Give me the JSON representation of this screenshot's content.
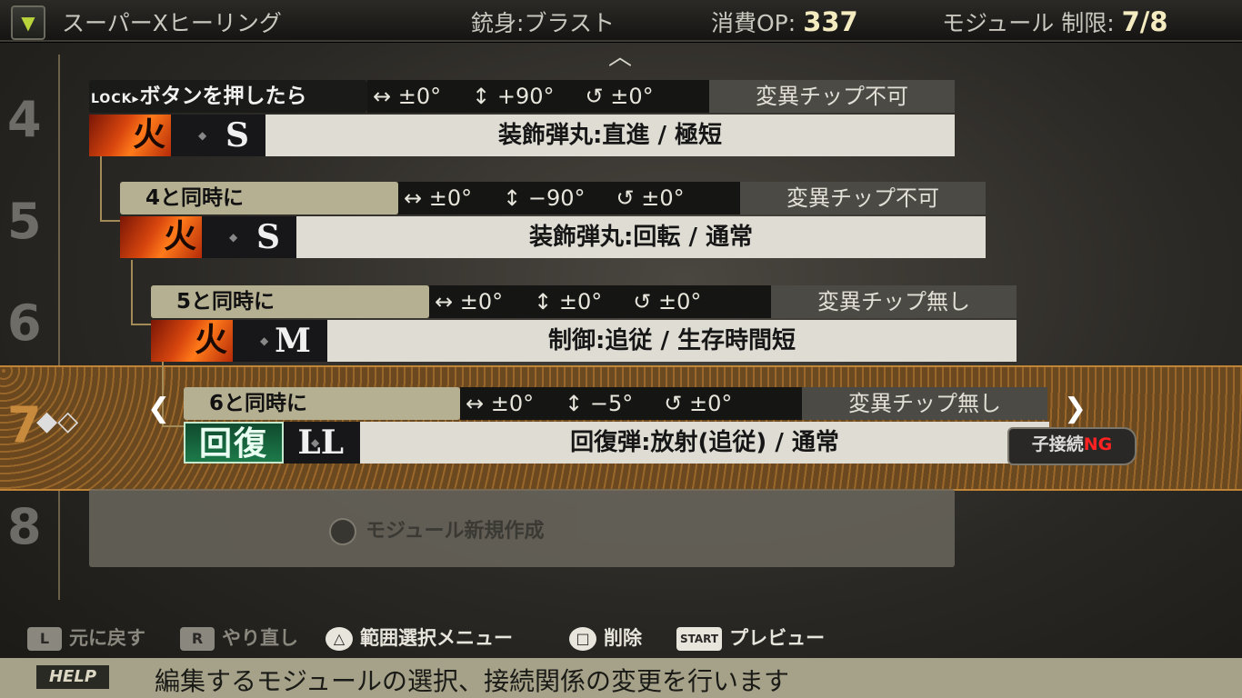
{
  "header": {
    "title": "スーパーXヒーリング",
    "barrel_label": "銃身:",
    "barrel_value": "ブラスト",
    "op_label": "消費OP:",
    "op_value": "337",
    "module_limit_label": "モジュール 制限:",
    "module_limit_value": "7/8"
  },
  "rows": [
    {
      "number": "4",
      "condition_prefix": "LOCK▸",
      "condition": "ボタンを押したら",
      "params": [
        "↔ ±0°",
        "↕ +90°",
        "↺ ±0°"
      ],
      "chip": "変異チップ不可",
      "element": "火",
      "size": "S",
      "description": "装飾弾丸:直進 / 極短"
    },
    {
      "number": "5",
      "condition": "4と同時に",
      "params": [
        "↔ ±0°",
        "↕ −90°",
        "↺ ±0°"
      ],
      "chip": "変異チップ不可",
      "element": "火",
      "size": "S",
      "description": "装飾弾丸:回転 / 通常"
    },
    {
      "number": "6",
      "condition": "5と同時に",
      "params": [
        "↔ ±0°",
        "↕ ±0°",
        "↺ ±0°"
      ],
      "chip": "変異チップ無し",
      "element": "火",
      "size": "M",
      "description": "制御:追従 / 生存時間短"
    },
    {
      "number": "7",
      "condition": "6と同時に",
      "params": [
        "↔ ±0°",
        "↕ −5°",
        "↺ ±0°"
      ],
      "chip": "変異チップ無し",
      "element": "回復",
      "size": "LL",
      "description": "回復弾:放射(追従) / 通常",
      "badge_prefix": "子接続",
      "badge_status": "NG"
    },
    {
      "number": "8",
      "new_module_label": "モジュール新規作成"
    }
  ],
  "controls": [
    {
      "button": "L",
      "label": "元に戻す",
      "enabled": false
    },
    {
      "button": "R",
      "label": "やり直し",
      "enabled": false
    },
    {
      "button": "△",
      "label": "範囲選択メニュー",
      "enabled": true
    },
    {
      "button": "□",
      "label": "削除",
      "enabled": true
    },
    {
      "button": "START",
      "label": "プレビュー",
      "enabled": true
    }
  ],
  "help": {
    "tag": "HELP",
    "message": "編集するモジュールの選択、接続関係の変更を行います"
  },
  "colors": {
    "condition_bg": "#b6b093",
    "selected_band": "#8a5a22",
    "ng_red": "#ff2222",
    "heal_green": "#1d7a4a"
  }
}
